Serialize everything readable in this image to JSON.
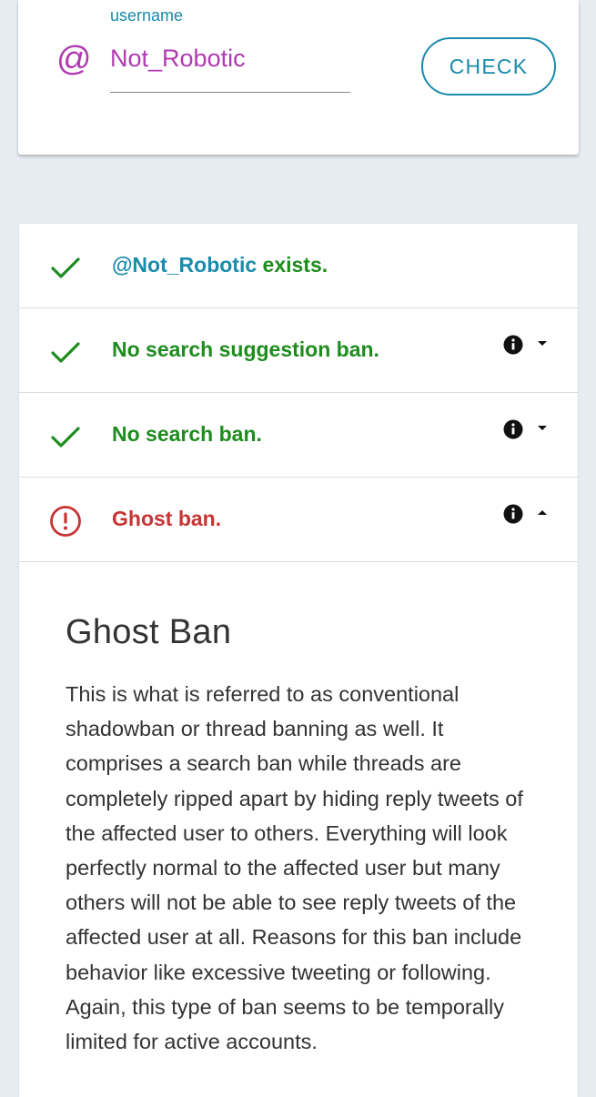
{
  "search": {
    "label": "username",
    "at_symbol": "@",
    "value": "Not_Robotic",
    "check_label": "CHECK"
  },
  "results": [
    {
      "status": "ok",
      "icon": "check-icon",
      "prefix": "@Not_Robotic",
      "text": " exists.",
      "has_info": false
    },
    {
      "status": "ok",
      "icon": "check-icon",
      "text": "No search suggestion ban.",
      "has_info": true,
      "expanded": false
    },
    {
      "status": "ok",
      "icon": "check-icon",
      "text": "No search ban.",
      "has_info": true,
      "expanded": false
    },
    {
      "status": "bad",
      "icon": "alert-circle-icon",
      "text": "Ghost ban.",
      "has_info": true,
      "expanded": true
    }
  ],
  "detail": {
    "title": "Ghost Ban",
    "body": "This is what is referred to as conventional shadowban or thread banning as well. It comprises a search ban while threads are completely ripped apart by hiding reply tweets of the affected user to others. Everything will look perfectly normal to the affected user but many others will not be able to see reply tweets of the affected user at all. Reasons for this ban include behavior like excessive tweeting or following. Again, this type of ban seems to be temporally limited for active accounts."
  },
  "colors": {
    "accent": "#1a8bab",
    "username": "#b03ab0",
    "ok": "#1e8c1e",
    "bad": "#c73434",
    "background": "#e6ecf2"
  }
}
